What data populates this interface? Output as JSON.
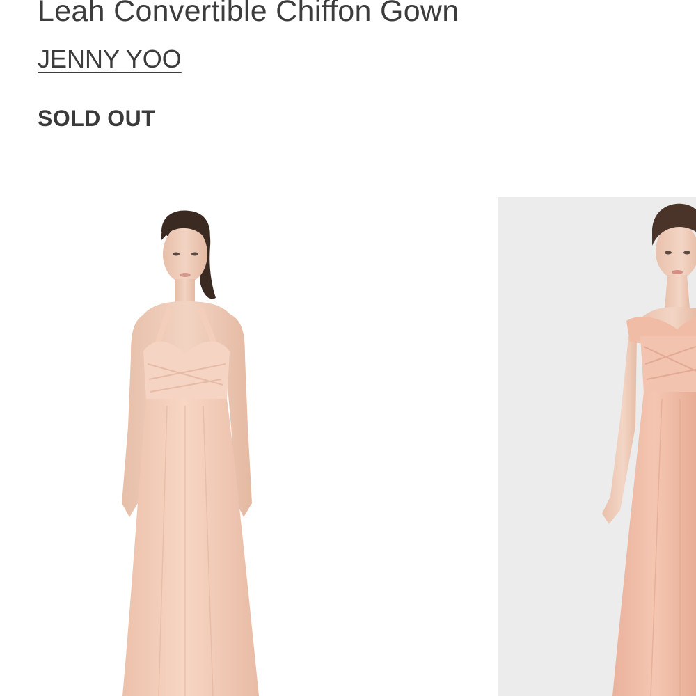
{
  "product": {
    "title": "Leah Convertible Chiffon Gown",
    "brand": "JENNY YOO",
    "availability": "SOLD OUT"
  },
  "gallery": {
    "images": [
      {
        "alt": "Model wearing blush halter-neck chiffon gown, front view"
      },
      {
        "alt": "Model wearing blush off-shoulder chiffon gown, front view"
      }
    ]
  },
  "colors": {
    "text": "#3c3c3c",
    "gown_blush": "#f5cfbd",
    "gown_shadow": "#e9b8a3",
    "skin": "#efcbb8",
    "hair": "#3a2a22",
    "photo_bg_2": "#ececec"
  }
}
